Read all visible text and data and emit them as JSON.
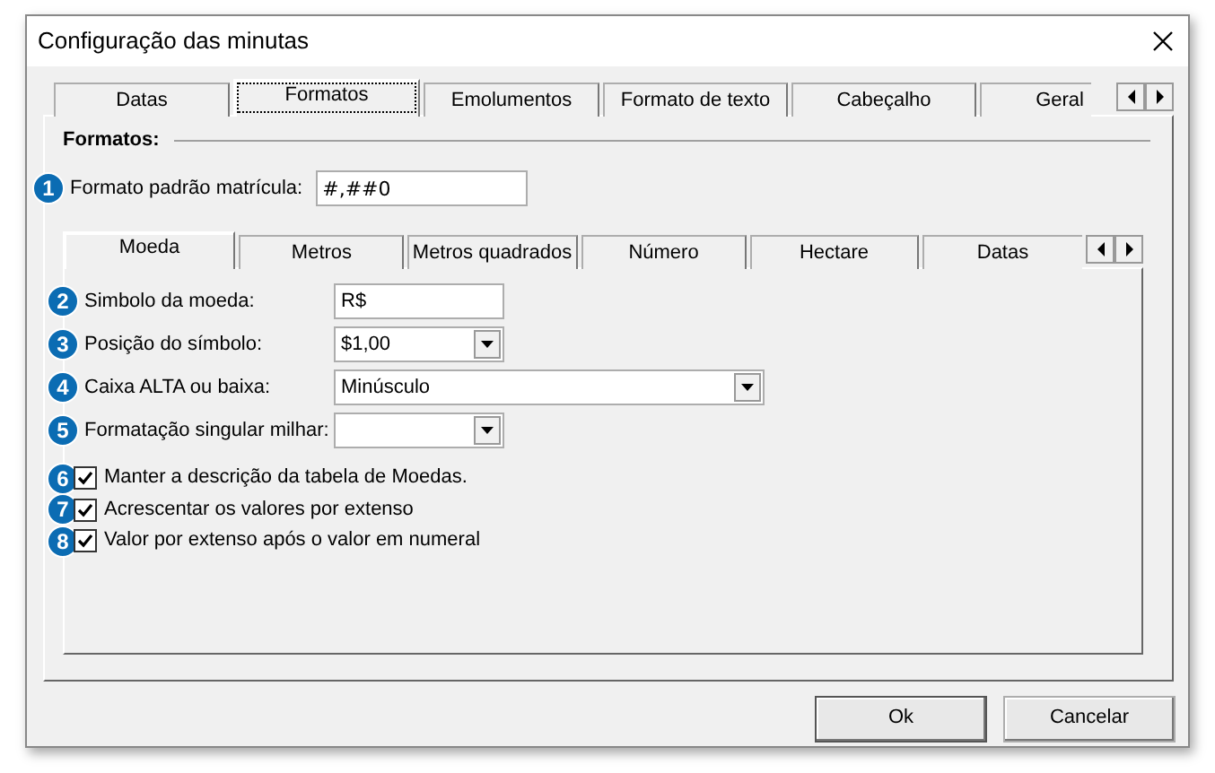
{
  "window": {
    "title": "Configuração das minutas"
  },
  "outer_tabs": [
    {
      "label": "Datas",
      "selected": false
    },
    {
      "label": "Formatos",
      "selected": true
    },
    {
      "label": "Emolumentos",
      "selected": false
    },
    {
      "label": "Formato de texto",
      "selected": false
    },
    {
      "label": "Cabeçalho",
      "selected": false
    },
    {
      "label": "Geral",
      "selected": false
    }
  ],
  "section": {
    "title": "Formatos:",
    "badge": "1",
    "label": "Formato padrão matrícula:",
    "value": "#,##0"
  },
  "inner_tabs": [
    {
      "label": "Moeda",
      "selected": true
    },
    {
      "label": "Metros",
      "selected": false
    },
    {
      "label": "Metros quadrados",
      "selected": false
    },
    {
      "label": "Número",
      "selected": false
    },
    {
      "label": "Hectare",
      "selected": false
    },
    {
      "label": "Datas",
      "selected": false
    }
  ],
  "fields": [
    {
      "badge": "2",
      "kind": "text",
      "label": "Simbolo da moeda:",
      "value": "R$"
    },
    {
      "badge": "3",
      "kind": "dropdown",
      "label": "Posição do símbolo:",
      "value": "$1,00"
    },
    {
      "badge": "4",
      "kind": "dropdown",
      "label": "Caixa ALTA ou baixa:",
      "value": "Minúsculo"
    },
    {
      "badge": "5",
      "kind": "dropdown",
      "label": "Formatação singular milhar:"
    }
  ],
  "checkboxes": [
    {
      "badge": "6",
      "label": "Manter a descrição da tabela de Moedas.",
      "checked": true
    },
    {
      "badge": "7",
      "label": "Acrescentar os valores por extenso",
      "checked": true
    },
    {
      "badge": "8",
      "label": "Valor por extenso após o valor em numeral",
      "checked": true
    }
  ],
  "buttons": [
    {
      "label": "Ok",
      "default": true
    },
    {
      "label": "Cancelar",
      "default": false
    }
  ]
}
